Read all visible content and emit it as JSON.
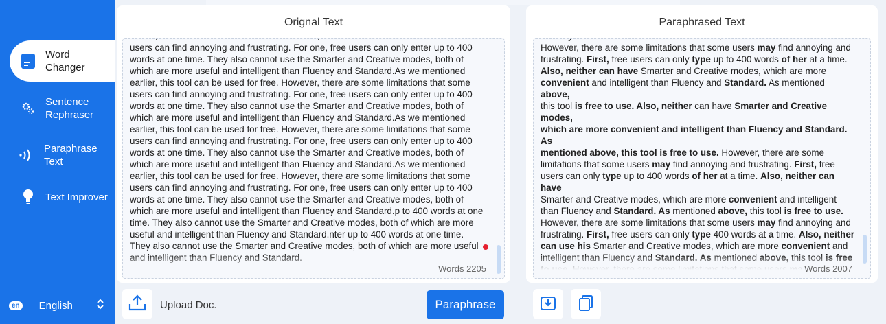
{
  "sidebar": {
    "items": [
      {
        "label_1": "Word",
        "label_2": "Changer"
      },
      {
        "label_1": "Sentence",
        "label_2": "Rephraser"
      },
      {
        "label_1": "Paraphrase",
        "label_2": "Text"
      },
      {
        "label_1": "Text Improver"
      }
    ],
    "language": {
      "code": "en",
      "label": "English"
    }
  },
  "original": {
    "title": "Orignal Text",
    "word_count": "Words 2205",
    "lines": [
      "earlier, this tool can be used for free. However, there are some limitations that some",
      "users can find annoying and frustrating. For one, free users can only enter up to 400",
      "words at one time. They also cannot use the Smarter and Creative modes, both of",
      "which are more useful and intelligent than Fluency and Standard.As we mentioned",
      "earlier, this tool can be used for free. However, there are some limitations that some",
      "users can find annoying and frustrating. For one, free users can only enter up to 400",
      "words at one time. They also cannot use the Smarter and Creative modes, both of",
      "which are more useful and intelligent than Fluency and Standard.As we mentioned",
      "earlier, this tool can be used for free. However, there are some limitations that some",
      "users can find annoying and frustrating. For one, free users can only enter up to 400",
      "words at one time. They also cannot use the Smarter and Creative modes, both of",
      "which are more useful and intelligent than Fluency and Standard.As we mentioned",
      "earlier, this tool can be used for free. However, there are some limitations that some",
      "users can find annoying and frustrating. For one, free users can only enter up to 400",
      "words at one time. They also cannot use the Smarter and Creative modes, both of",
      "which are more useful and intelligent than Fluency and Standard.p to 400 words at one",
      "time. They also cannot use the Smarter and Creative modes, both of which are more",
      "useful and intelligent than Fluency and Standard.nter up to 400 words at one time.",
      "They also cannot use the Smarter and Creative modes, both of which are more useful",
      "and intelligent than Fluency and Standard."
    ]
  },
  "paraphrased": {
    "title": "Paraphrased Text",
    "word_count": "Words 2007"
  },
  "toolbar": {
    "upload_label": "Upload Doc.",
    "paraphrase_label": "Paraphrase"
  },
  "icons": {
    "word_changer": "document-icon",
    "sentence_rephraser": "gears-icon",
    "paraphrase_text": "sound-waves-icon",
    "text_improver": "lightbulb-icon",
    "upload": "upload-icon",
    "download": "download-icon",
    "copy": "copy-icon"
  },
  "colors": {
    "accent": "#1a73e8",
    "dot": "#e5202f"
  }
}
